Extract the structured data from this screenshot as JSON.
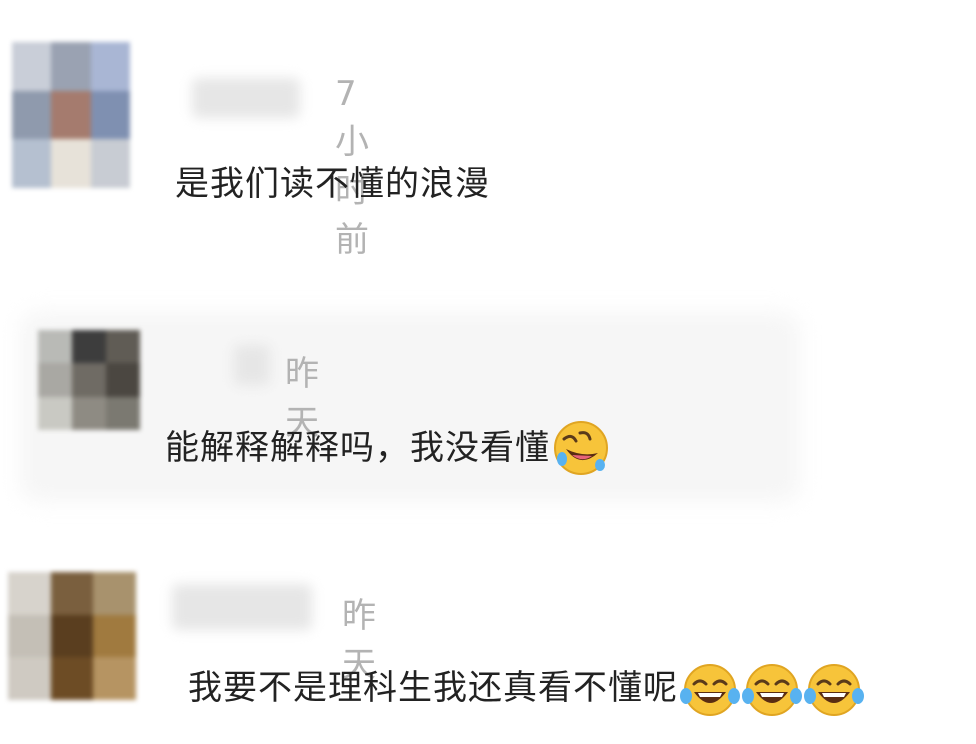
{
  "comments": [
    {
      "time": "7小时前",
      "text": "是我们读不懂的浪漫"
    },
    {
      "time": "昨天",
      "text": "能解释解释吗，我没看懂",
      "emoji": "rolling-laugh-emoji"
    },
    {
      "time": "昨天",
      "text": "我要不是理科生我还真看不懂呢",
      "emoji": "tears-of-joy-emoji",
      "emoji_count": 3
    }
  ],
  "colors": {
    "time": "#b3b3b3",
    "text": "#222222",
    "emoji": "#f7c43a"
  }
}
